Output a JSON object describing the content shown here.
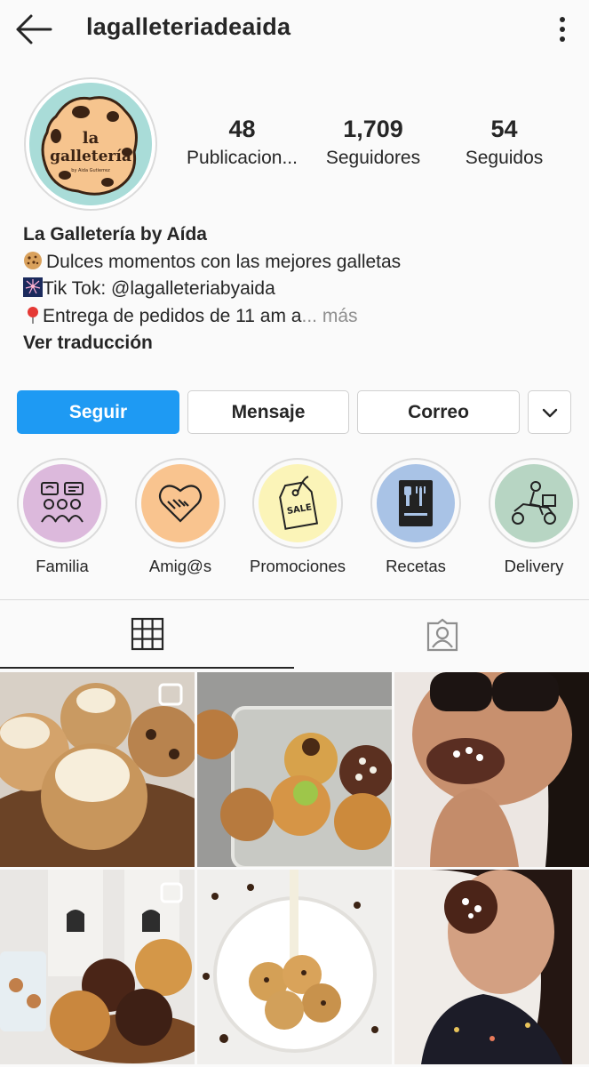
{
  "header": {
    "username": "lagalleteriadeaida",
    "back_icon": "arrow-left-icon",
    "menu_icon": "kebab-menu-icon"
  },
  "profile": {
    "avatar_text": "la galletería",
    "avatar_subtext": "by Aida Gutierrez",
    "stats": [
      {
        "value": "48",
        "label": "Publicacion..."
      },
      {
        "value": "1,709",
        "label": "Seguidores"
      },
      {
        "value": "54",
        "label": "Seguidos"
      }
    ]
  },
  "bio": {
    "name": "La Galletería by Aída",
    "line1": "Dulces momentos con las mejores galletas",
    "line2": "Tik Tok: @lagalleteriabyaida",
    "line3": "Entrega de pedidos de 11 am a",
    "more": "... más",
    "translate": "Ver traducción"
  },
  "actions": {
    "follow": "Seguir",
    "message": "Mensaje",
    "email": "Correo"
  },
  "highlights": [
    {
      "label": "Familia",
      "color": "#dcb9dc"
    },
    {
      "label": "Amig@s",
      "color": "#f9c48f"
    },
    {
      "label": "Promociones",
      "color": "#fbf4b8"
    },
    {
      "label": "Recetas",
      "color": "#a9c3e6"
    },
    {
      "label": "Delivery",
      "color": "#b7d5c3"
    }
  ],
  "tabs": {
    "grid_icon": "grid-icon",
    "tagged_icon": "tagged-person-icon"
  },
  "colors": {
    "accent": "#1e9af3",
    "text": "#262626",
    "muted": "#8e8e8e",
    "border": "#dbdbdb"
  }
}
